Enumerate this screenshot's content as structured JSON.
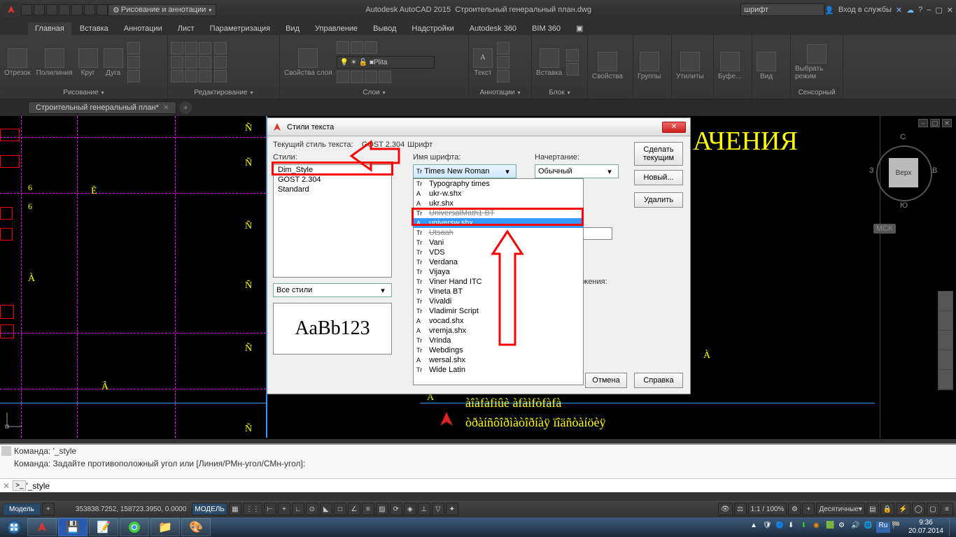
{
  "titlebar": {
    "workspace": "Рисование и аннотации",
    "app": "Autodesk AutoCAD 2015",
    "doc": "Строительный генеральный план.dwg",
    "search_placeholder": "шрифт",
    "signin": "Вход в службы"
  },
  "ribbon": {
    "tabs": [
      "Главная",
      "Вставка",
      "Аннотации",
      "Лист",
      "Параметризация",
      "Вид",
      "Управление",
      "Вывод",
      "Надстройки",
      "Autodesk 360",
      "BIM 360"
    ],
    "active_tab": 0,
    "panels": {
      "draw": {
        "title": "Рисование",
        "items": [
          "Отрезок",
          "Полилиния",
          "Круг",
          "Дуга"
        ]
      },
      "edit": {
        "title": "Редактирование"
      },
      "layers": {
        "title": "Слои",
        "props_label": "Свойства слоя",
        "combo": "Plita"
      },
      "annotation": {
        "title": "Аннотации",
        "text_label": "Текст"
      },
      "block": {
        "title": "Блок",
        "insert_label": "Вставка"
      },
      "properties": {
        "title": "Свойства",
        "label": "Свойства"
      },
      "groups": {
        "title": "",
        "label": "Группы"
      },
      "utilities": {
        "title": "",
        "label": "Утилиты"
      },
      "clipboard": {
        "title": "",
        "label": "Буфе..."
      },
      "view": {
        "title": "",
        "label": "Вид"
      },
      "touch": {
        "title": "Сенсорный",
        "label": "Выбрать режим"
      }
    }
  },
  "filetab": {
    "name": "Строительный генеральный план*"
  },
  "dialog": {
    "title": "Стили текста",
    "current_label": "Текущий стиль текста:",
    "current_value": "GOST 2.304",
    "styles_label": "Стили:",
    "styles": [
      "Dim_Style",
      "GOST 2.304",
      "Standard"
    ],
    "filter_value": "Все стили",
    "font_section": "Шрифт",
    "font_name_label": "Имя шрифта:",
    "font_combo_value": "Times New Roman",
    "weight_label": "Начертание:",
    "weight_value": "Обычный",
    "btn_current": "Сделать текущим",
    "btn_new": "Новый...",
    "btn_delete": "Удалить",
    "btn_cancel": "Отмена",
    "btn_help": "Справка",
    "preview": "AaBb123",
    "stretch_label": "яжения:",
    "fonts": [
      {
        "t": "T",
        "n": "Typography times"
      },
      {
        "t": "S",
        "n": "ukr-w.shx"
      },
      {
        "t": "S",
        "n": "ukr.shx"
      },
      {
        "t": "T",
        "n": "UniversalMath1 BT"
      },
      {
        "t": "S",
        "n": "universw.shx"
      },
      {
        "t": "T",
        "n": "Utsaah"
      },
      {
        "t": "T",
        "n": "Vani"
      },
      {
        "t": "T",
        "n": "VDS"
      },
      {
        "t": "T",
        "n": "Verdana"
      },
      {
        "t": "T",
        "n": "Vijaya"
      },
      {
        "t": "T",
        "n": "Viner Hand ITC"
      },
      {
        "t": "T",
        "n": "Vineta BT"
      },
      {
        "t": "T",
        "n": "Vivaldi"
      },
      {
        "t": "T",
        "n": "Vladimir Script"
      },
      {
        "t": "S",
        "n": "vocad.shx"
      },
      {
        "t": "S",
        "n": "vremja.shx"
      },
      {
        "t": "T",
        "n": "Vrinda"
      },
      {
        "t": "T",
        "n": "Webdings"
      },
      {
        "t": "S",
        "n": "wersal.shx"
      },
      {
        "t": "T",
        "n": "Wide Latin"
      }
    ],
    "font_selected_index": 4
  },
  "viewcube": {
    "top": "Верх",
    "n": "С",
    "s": "Ю",
    "e": "В",
    "w": "З",
    "wcs": "МСК"
  },
  "canvas": {
    "big_yellow": "АЧЕНИЯ",
    "cy1": "àîàfàfiûè àfàìfòfàfà",
    "cy2": "òðàíñôîðìàòîðíàÿ ïîäñòàíöèÿ"
  },
  "command": {
    "hist1": "Команда: '_style",
    "hist2": "Команда: Задайте противоположный угол или [Линия/РМн-угол/СМн-угол]:",
    "input": "'_style"
  },
  "status": {
    "model": "Модель",
    "coords": "353838.7252, 158723.3950, 0.0000",
    "model_btn": "МОДЕЛЬ",
    "scale": "1:1 / 100%",
    "units": "Десятичные"
  },
  "taskbar": {
    "time": "9:36",
    "date": "20.07.2014",
    "lang": "Ru"
  }
}
